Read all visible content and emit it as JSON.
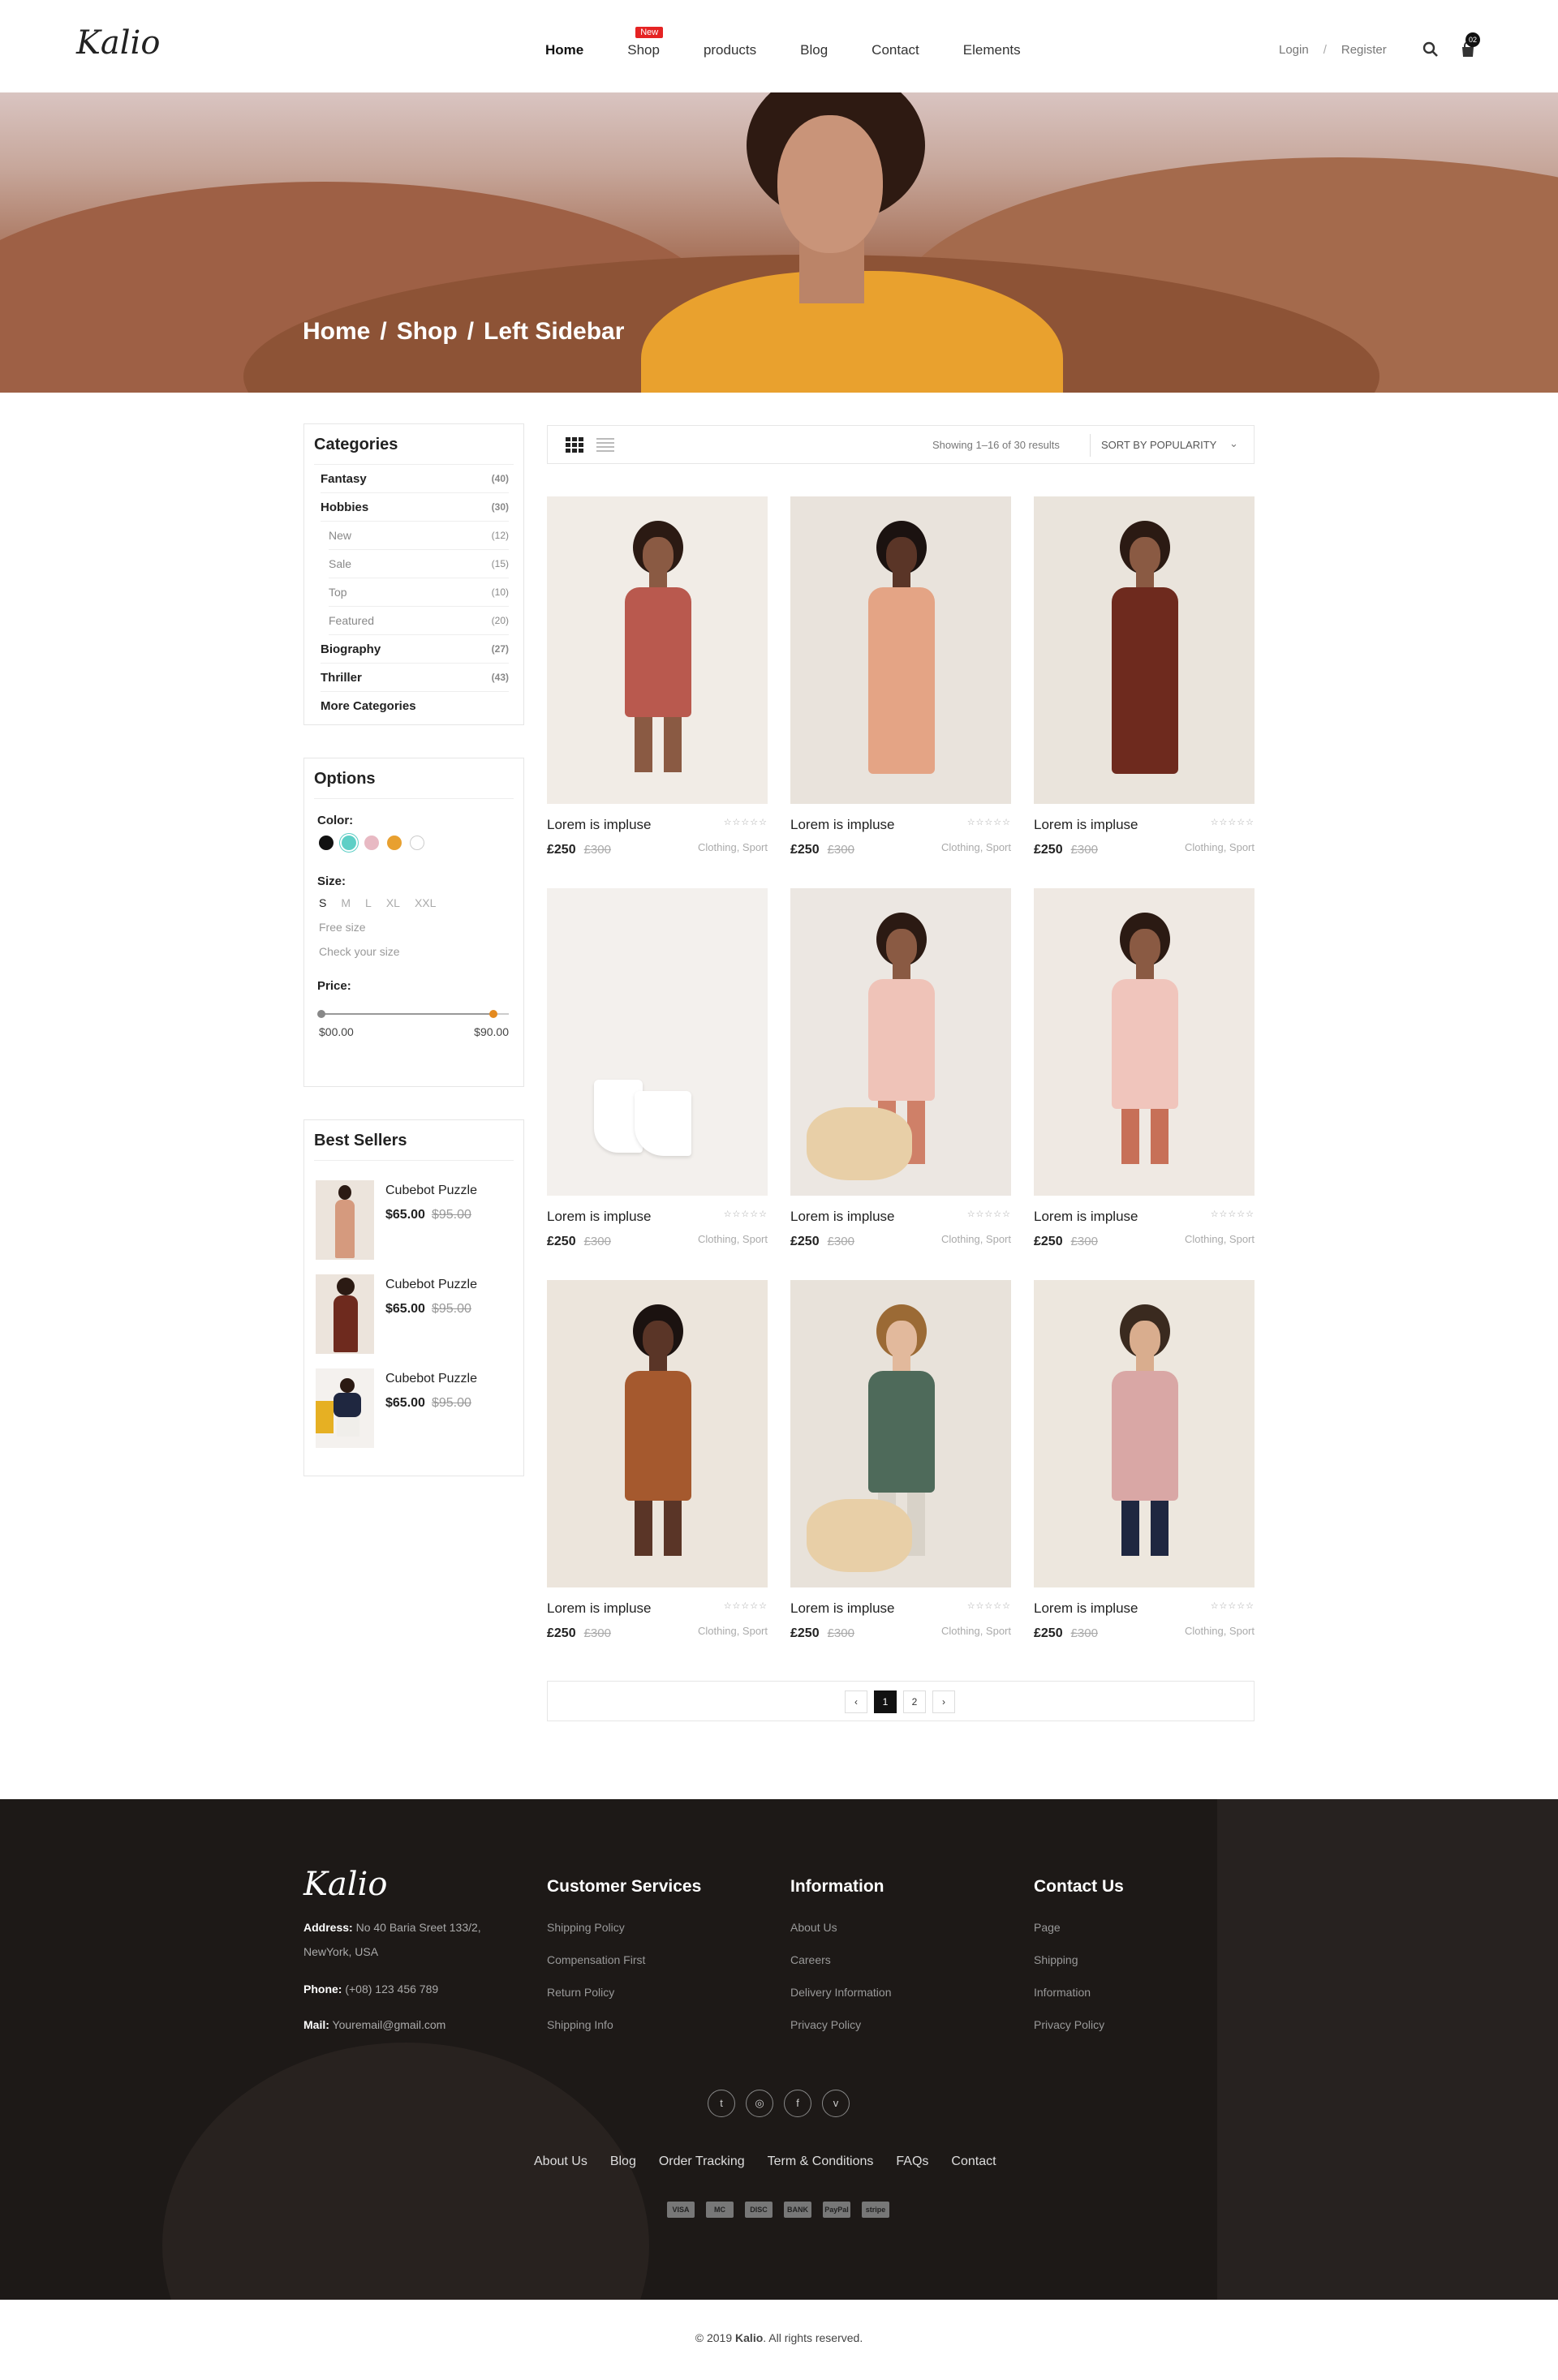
{
  "header": {
    "logo": "Kalio",
    "nav": [
      {
        "label": "Home"
      },
      {
        "label": "Shop",
        "badge": "New"
      },
      {
        "label": "products"
      },
      {
        "label": "Blog"
      },
      {
        "label": "Contact"
      },
      {
        "label": "Elements"
      }
    ],
    "login": "Login",
    "separator": "/",
    "register": "Register",
    "cart_count": "02"
  },
  "hero": {
    "breadcrumb": [
      "Home",
      "/",
      "Shop",
      "/",
      "Left Sidebar"
    ]
  },
  "categories": {
    "title": "Categories",
    "items": [
      {
        "label": "Fantasy",
        "count": "(40)",
        "level": "main"
      },
      {
        "label": "Hobbies",
        "count": "(30)",
        "level": "main"
      },
      {
        "label": "New",
        "count": "(12)",
        "level": "sub"
      },
      {
        "label": "Sale",
        "count": "(15)",
        "level": "sub"
      },
      {
        "label": "Top",
        "count": "(10)",
        "level": "sub"
      },
      {
        "label": "Featured",
        "count": "(20)",
        "level": "sub"
      },
      {
        "label": "Biography",
        "count": "(27)",
        "level": "main"
      },
      {
        "label": "Thriller",
        "count": "(43)",
        "level": "main"
      }
    ],
    "more": "More Categories"
  },
  "options": {
    "title": "Options",
    "color_label": "Color:",
    "colors": [
      "#111111",
      "#5ecfc6",
      "#e8b9c3",
      "#e8a030",
      "#ffffff"
    ],
    "size_label": "Size:",
    "sizes": [
      "S",
      "M",
      "L",
      "XL",
      "XXL"
    ],
    "free_size": "Free size",
    "check_size": "Check your size",
    "price_label": "Price:",
    "price_min": "$00.00",
    "price_max": "$90.00",
    "price_level": 0.92
  },
  "best_sellers": {
    "title": "Best Sellers",
    "items": [
      {
        "name": "Cubebot Puzzle",
        "price": "$65.00",
        "old_price": "$95.00"
      },
      {
        "name": "Cubebot Puzzle",
        "price": "$65.00",
        "old_price": "$95.00"
      },
      {
        "name": "Cubebot Puzzle",
        "price": "$65.00",
        "old_price": "$95.00"
      }
    ]
  },
  "toolbar": {
    "showing": "Showing 1–16 of 30 results",
    "sort": "Sort by popularity"
  },
  "products": [
    {
      "title": "Lorem is impluse",
      "price": "£250",
      "old_price": "£300",
      "tags": "Clothing, Sport",
      "stars": "☆☆☆☆☆"
    },
    {
      "title": "Lorem is impluse",
      "price": "£250",
      "old_price": "£300",
      "tags": "Clothing, Sport",
      "stars": "☆☆☆☆☆"
    },
    {
      "title": "Lorem is impluse",
      "price": "£250",
      "old_price": "£300",
      "tags": "Clothing, Sport",
      "stars": "☆☆☆☆☆"
    },
    {
      "title": "Lorem is impluse",
      "price": "£250",
      "old_price": "£300",
      "tags": "Clothing, Sport",
      "stars": "☆☆☆☆☆"
    },
    {
      "title": "Lorem is impluse",
      "price": "£250",
      "old_price": "£300",
      "tags": "Clothing, Sport",
      "stars": "☆☆☆☆☆"
    },
    {
      "title": "Lorem is impluse",
      "price": "£250",
      "old_price": "£300",
      "tags": "Clothing, Sport",
      "stars": "☆☆☆☆☆"
    },
    {
      "title": "Lorem is impluse",
      "price": "£250",
      "old_price": "£300",
      "tags": "Clothing, Sport",
      "stars": "☆☆☆☆☆"
    },
    {
      "title": "Lorem is impluse",
      "price": "£250",
      "old_price": "£300",
      "tags": "Clothing, Sport",
      "stars": "☆☆☆☆☆"
    },
    {
      "title": "Lorem is impluse",
      "price": "£250",
      "old_price": "£300",
      "tags": "Clothing, Sport",
      "stars": "☆☆☆☆☆"
    }
  ],
  "pagination": {
    "prev": "‹",
    "pages": [
      "1",
      "2"
    ],
    "next": "›",
    "current": "1"
  },
  "footer": {
    "logo": "Kalio",
    "address_label": "Address:",
    "address_line1": "No 40 Baria Sreet 133/2,",
    "address_line2": "NewYork, USA",
    "phone_label": "Phone:",
    "phone": "(+08) 123 456 789",
    "mail_label": "Mail:",
    "mail": "Youremail@gmail.com",
    "columns": [
      {
        "title": "Customer Services",
        "links": [
          "Shipping Policy",
          "Compensation First",
          "Return Policy",
          "Shipping Info"
        ]
      },
      {
        "title": "Information",
        "links": [
          "About Us",
          "Careers",
          "Delivery Information",
          "Privacy Policy"
        ]
      },
      {
        "title": "Contact Us",
        "links": [
          "Page",
          "Shipping",
          "Information",
          "Privacy Policy"
        ]
      }
    ],
    "social": [
      "twitter-icon",
      "dribbble-icon",
      "facebook-icon",
      "vimeo-icon"
    ],
    "bottom_links": [
      "About Us",
      "Blog",
      "Order Tracking",
      "Term & Conditions",
      "FAQs",
      "Contact"
    ],
    "payments": [
      "VISA",
      "MC",
      "DISC",
      "BANK",
      "PayPal",
      "stripe"
    ],
    "copyright_prefix": "© 2019",
    "copyright_brand": "Kalio",
    "copyright_suffix": ". All rights reserved."
  }
}
